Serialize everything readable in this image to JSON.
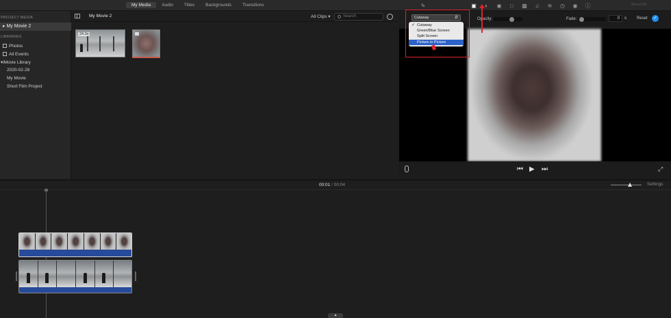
{
  "top_tabs": {
    "my_media": "My Media",
    "audio": "Audio",
    "titles": "Titles",
    "backgrounds": "Backgrounds",
    "transitions": "Transitions"
  },
  "top_reset": "Reset All",
  "sidebar": {
    "project_media_header": "PROJECT MEDIA",
    "project_item": "My Movie 2",
    "libraries_header": "LIBRARIES",
    "photos": "Photos",
    "all_events": "All Events",
    "library": "iMovie Library",
    "date_event": "2020-02-28",
    "my_movie": "My Movie",
    "short_film": "Short Film Project"
  },
  "browser": {
    "project_title": "My Movie 2",
    "filter": "All Clips ▾",
    "search_placeholder": "Search",
    "clip_duration": "24.3s"
  },
  "overlay": {
    "selected": "Cutaway",
    "options": [
      "Cutaway",
      "Green/Blue Screen",
      "Split Screen",
      "Picture in Picture"
    ],
    "checkmark": "✓",
    "opacity_label": "Opacity:",
    "opacity_level": 0.65,
    "fade_label": "Fade:",
    "fade_value": "0",
    "fade_unit": "s",
    "reset_label": "Reset",
    "reset_check": "✓"
  },
  "viewer": {
    "prev": "⏮",
    "play": "▶",
    "next": "⏭",
    "fullscreen": "⤢"
  },
  "timeline": {
    "current": "00:01",
    "separator": "/",
    "total": "00:04",
    "settings": "Settings",
    "bottom_handle": "▴"
  },
  "colors": {
    "accent_blue": "#1f8ff2",
    "annotation_red": "#e0222b",
    "clip_blue": "#274b9a",
    "menu_highlight": "#2d62c9"
  },
  "icons": {
    "inspector_tools": [
      "magic-wand-icon",
      "overlay-icon",
      "color-balance-icon",
      "color-correction-icon",
      "crop-icon",
      "stabilization-icon",
      "volume-icon",
      "noise-reduction-icon",
      "speed-icon",
      "filter-icon",
      "info-icon"
    ]
  }
}
